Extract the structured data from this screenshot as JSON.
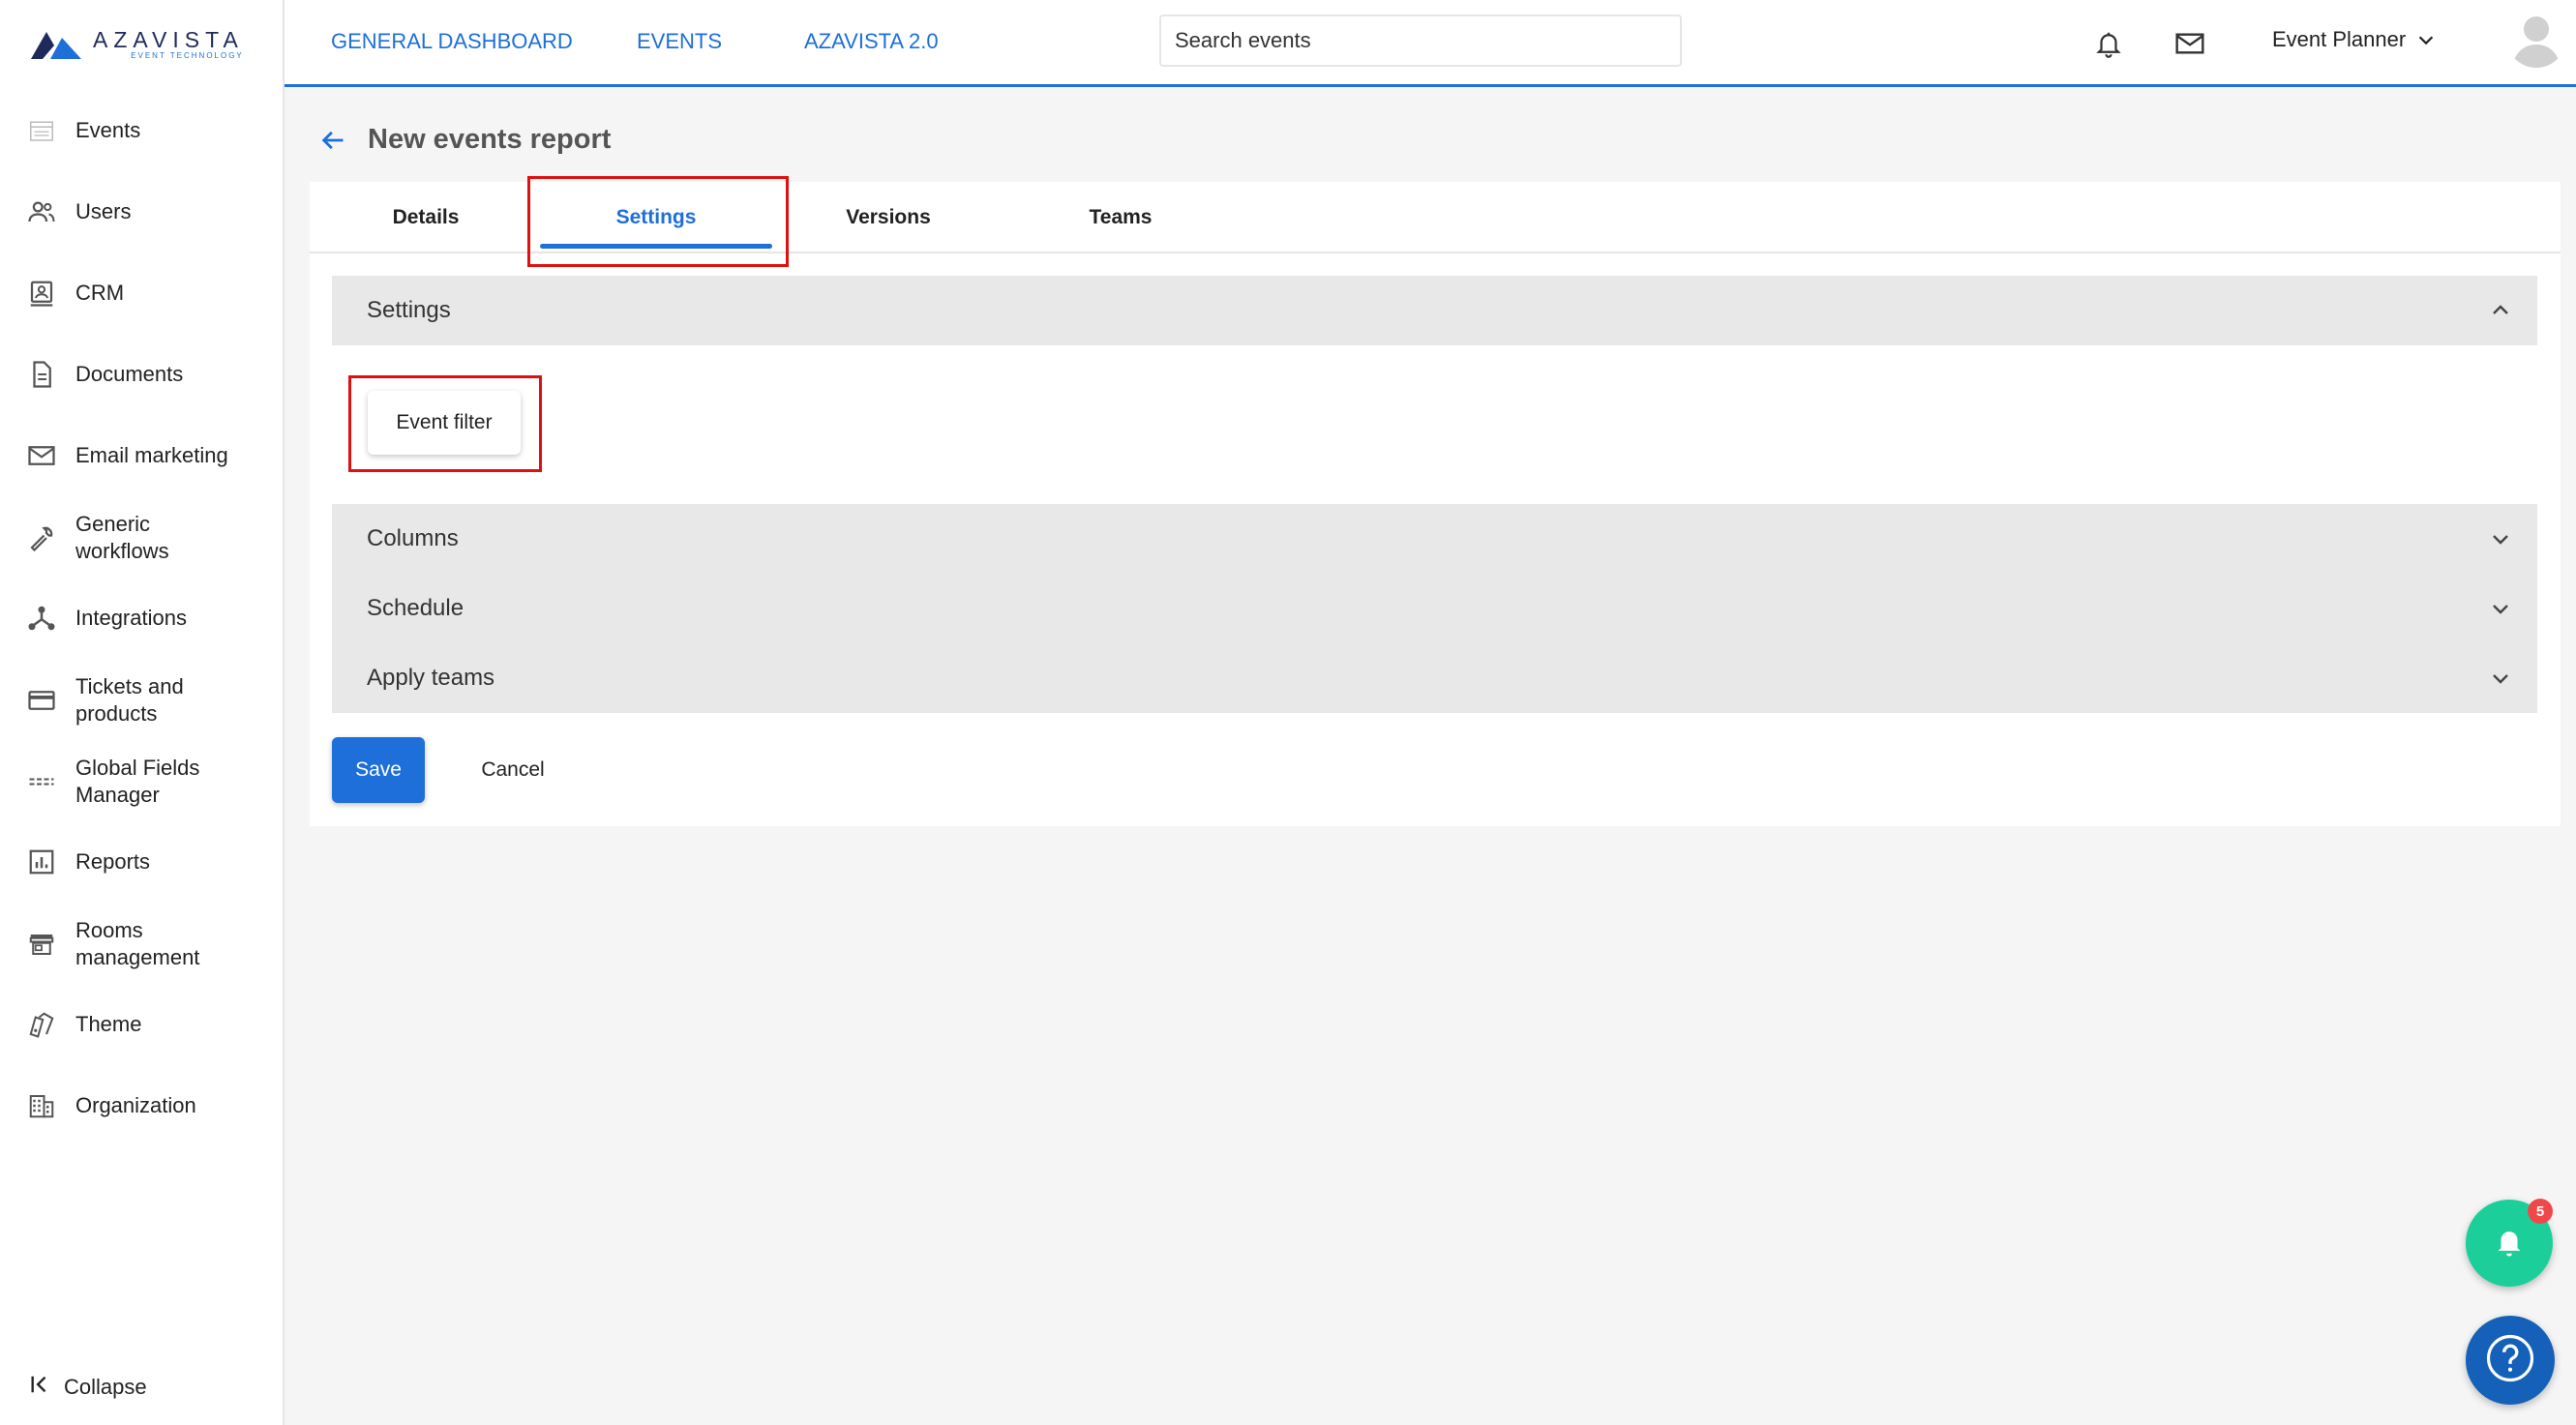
{
  "brand": {
    "name": "AZAVISTA",
    "tagline": "EVENT TECHNOLOGY",
    "colors": {
      "primary": "#1e6fd9",
      "navy": "#1e2a5a",
      "highlight": "#e01010",
      "fab_green": "#1ccf9a",
      "help_blue": "#1560b8"
    }
  },
  "topnav": {
    "links": [
      {
        "label": "GENERAL DASHBOARD"
      },
      {
        "label": "EVENTS"
      },
      {
        "label": "AZAVISTA 2.0"
      }
    ],
    "search": {
      "placeholder": "Search events",
      "value": ""
    },
    "icons": [
      "bell-icon",
      "mail-icon"
    ],
    "user": {
      "role": "Event Planner"
    }
  },
  "sidebar": {
    "items": [
      {
        "label": "Events",
        "icon": "calendar-list-icon"
      },
      {
        "label": "Users",
        "icon": "users-icon"
      },
      {
        "label": "CRM",
        "icon": "contact-card-icon"
      },
      {
        "label": "Documents",
        "icon": "document-icon"
      },
      {
        "label": "Email marketing",
        "icon": "mail-icon"
      },
      {
        "label": "Generic\nworkflows",
        "icon": "wrench-icon"
      },
      {
        "label": "Integrations",
        "icon": "share-nodes-icon"
      },
      {
        "label": "Tickets and\nproducts",
        "icon": "credit-card-icon"
      },
      {
        "label": "Global Fields\nManager",
        "icon": "fields-icon"
      },
      {
        "label": "Reports",
        "icon": "bar-chart-icon"
      },
      {
        "label": "Rooms\nmanagement",
        "icon": "store-icon"
      },
      {
        "label": "Theme",
        "icon": "palette-icon"
      },
      {
        "label": "Organization",
        "icon": "building-icon"
      }
    ],
    "collapse_label": "Collapse"
  },
  "page": {
    "title": "New events report",
    "tabs": [
      {
        "label": "Details",
        "active": false
      },
      {
        "label": "Settings",
        "active": true
      },
      {
        "label": "Versions",
        "active": false
      },
      {
        "label": "Teams",
        "active": false
      }
    ],
    "sections": {
      "settings": {
        "label": "Settings",
        "expanded": true,
        "filter_button": "Event filter"
      },
      "columns": {
        "label": "Columns",
        "expanded": false
      },
      "schedule": {
        "label": "Schedule",
        "expanded": false
      },
      "apply_teams": {
        "label": "Apply teams",
        "expanded": false
      }
    },
    "actions": {
      "save": "Save",
      "cancel": "Cancel"
    }
  },
  "floating": {
    "notifications_count": "5"
  }
}
